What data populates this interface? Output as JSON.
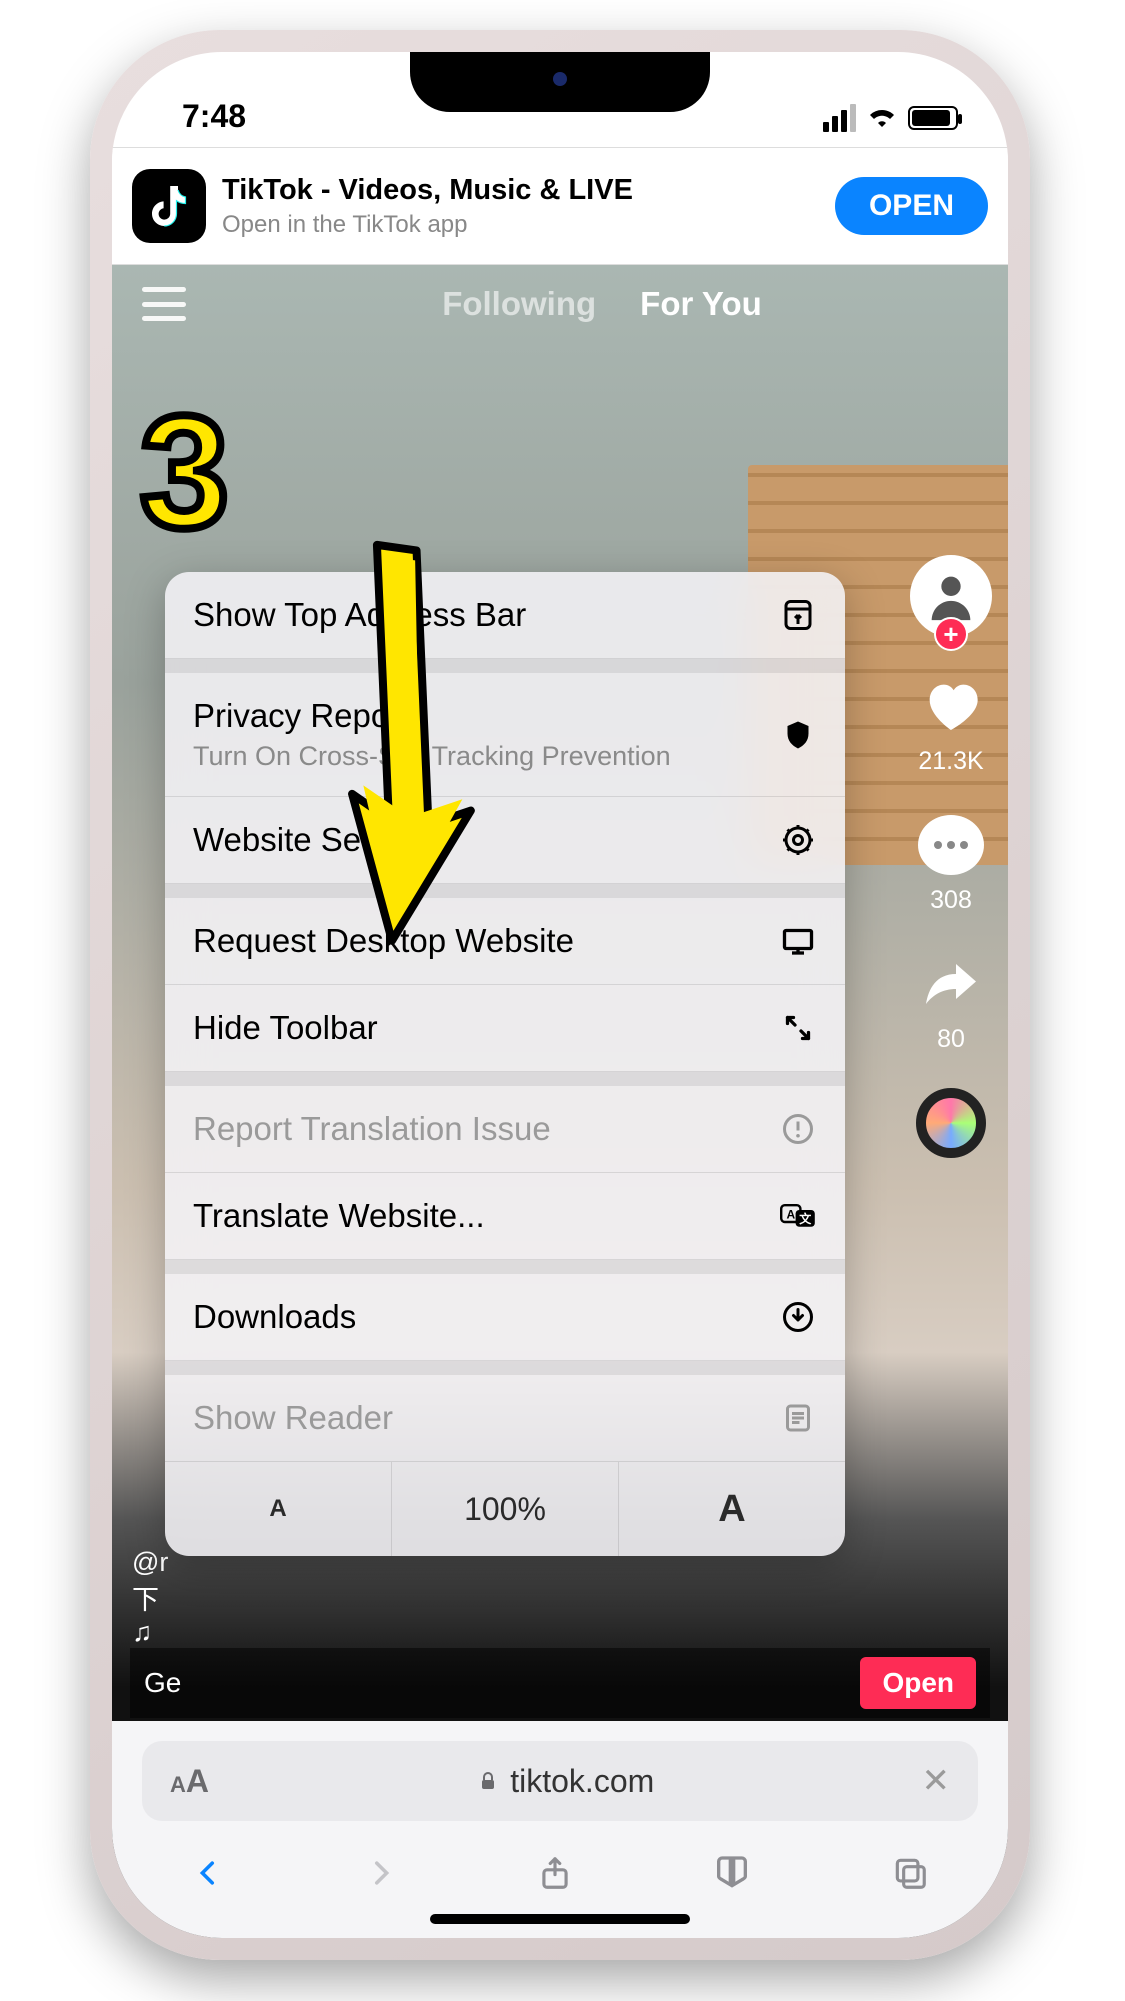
{
  "status_bar": {
    "time": "7:48"
  },
  "app_banner": {
    "title": "TikTok - Videos, Music & LIVE",
    "subtitle": "Open in the TikTok app",
    "open_label": "OPEN"
  },
  "tiktok_nav": {
    "following": "Following",
    "for_you": "For You"
  },
  "rail": {
    "likes": "21.3K",
    "comments": "308",
    "shares": "80"
  },
  "caption": {
    "username": "@r",
    "line2": "下",
    "music_prefix": "♫"
  },
  "bottom_banner": {
    "get_label": "Ge",
    "open_label": "Open"
  },
  "safari_menu": {
    "items": [
      {
        "label": "Show Top Address Bar",
        "sub": "",
        "disabled": false,
        "icon": "addressbar"
      },
      {
        "label": "Privacy Report",
        "sub": "Turn On Cross-Site Tracking Prevention",
        "disabled": false,
        "icon": "shield"
      },
      {
        "label": "Website Settings",
        "sub": "",
        "disabled": false,
        "icon": "gear"
      },
      {
        "label": "Request Desktop Website",
        "sub": "",
        "disabled": false,
        "icon": "desktop"
      },
      {
        "label": "Hide Toolbar",
        "sub": "",
        "disabled": false,
        "icon": "expand"
      },
      {
        "label": "Report Translation Issue",
        "sub": "",
        "disabled": true,
        "icon": "warning"
      },
      {
        "label": "Translate Website...",
        "sub": "",
        "disabled": false,
        "icon": "translate"
      },
      {
        "label": "Downloads",
        "sub": "",
        "disabled": false,
        "icon": "download"
      },
      {
        "label": "Show Reader",
        "sub": "",
        "disabled": true,
        "icon": "reader"
      }
    ],
    "zoom": {
      "level": "100%"
    }
  },
  "url_bar": {
    "domain": "tiktok.com"
  },
  "annotation": {
    "step_number": "3"
  }
}
